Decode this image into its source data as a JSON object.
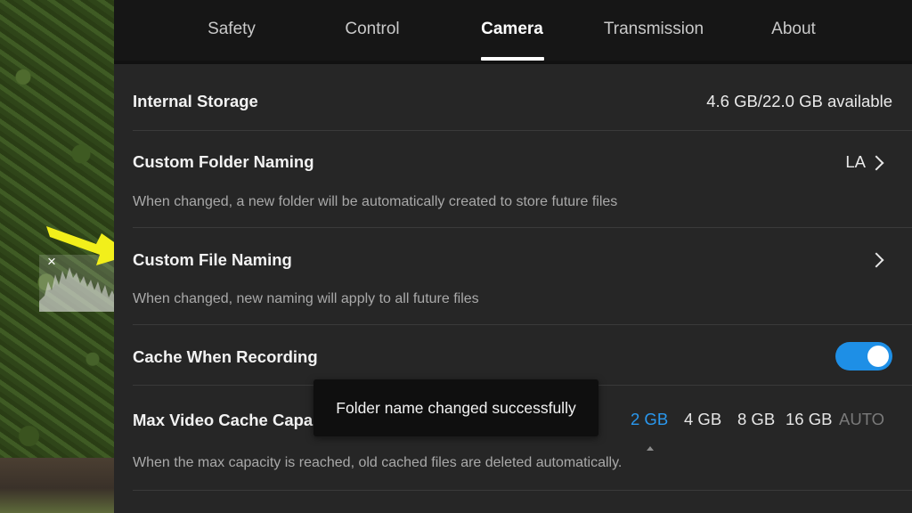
{
  "tabs": [
    {
      "label": "Safety",
      "active": false
    },
    {
      "label": "Control",
      "active": false
    },
    {
      "label": "Camera",
      "active": true
    },
    {
      "label": "Transmission",
      "active": false
    },
    {
      "label": "About",
      "active": false
    }
  ],
  "settings": {
    "internal_storage": {
      "title": "Internal Storage",
      "value": "4.6 GB/22.0 GB available"
    },
    "custom_folder_naming": {
      "title": "Custom Folder Naming",
      "value": "LA",
      "description": "When changed, a new folder will be automatically created to store future files"
    },
    "custom_file_naming": {
      "title": "Custom File Naming",
      "description": "When changed, new naming will apply to all future files"
    },
    "cache_when_recording": {
      "title": "Cache When Recording",
      "enabled": true
    },
    "max_video_cache_capacity": {
      "title": "Max Video Cache Capacity",
      "options": [
        "2 GB",
        "4 GB",
        "8 GB",
        "16 GB",
        "AUTO"
      ],
      "selected": "2 GB",
      "description": "When the max capacity is reached, old cached files are deleted automatically."
    }
  },
  "toast": {
    "message": "Folder name changed successfully"
  },
  "colors": {
    "accent": "#1e8fe6",
    "selected_option": "#2a98ee",
    "annotation_arrow": "#f2ef1b"
  },
  "icons": {
    "histogram_close": "×",
    "row_chevron": "chevron-right-icon"
  }
}
